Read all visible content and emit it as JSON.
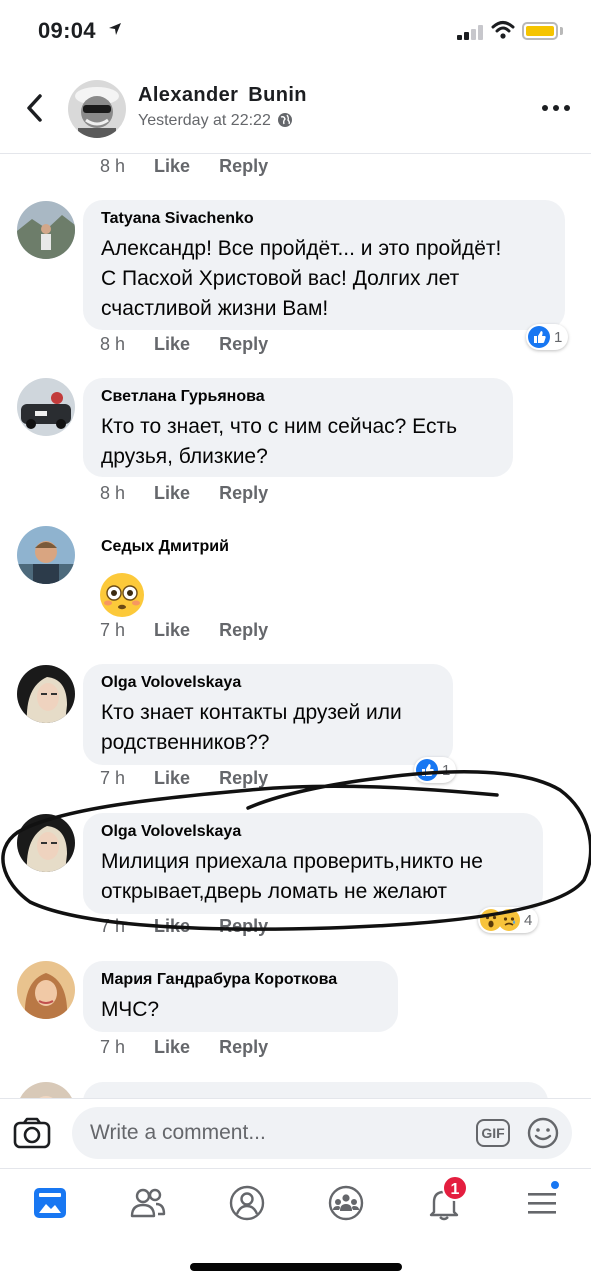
{
  "status_bar": {
    "time": "09:04"
  },
  "header": {
    "name": "Alexander  Bunin",
    "meta": "Yesterday at 22:22"
  },
  "top_actions": {
    "time": "8 h",
    "like": "Like",
    "reply": "Reply"
  },
  "comments": [
    {
      "author": "Tatyana  Sivachenko",
      "lines": [
        "Александр! Все пройдёт... и это пройдёт!",
        "С Пасхой Христовой вас! Долгих лет",
        "счастливой жизни Вам!"
      ],
      "time": "8 h",
      "like": "Like",
      "reply": "Reply",
      "reaction_count": "1"
    },
    {
      "author": "Светлана Гурьянова",
      "lines": [
        "Кто то знает, что с ним сейчас? Есть",
        "друзья, близкие?"
      ],
      "time": "8 h",
      "like": "Like",
      "reply": "Reply"
    },
    {
      "author": "Седых Дмитрий",
      "lines": [],
      "emoji": "flushed-face",
      "time": "7 h",
      "like": "Like",
      "reply": "Reply"
    },
    {
      "author": "Olga Volovelskaya",
      "lines": [
        "Кто знает контакты друзей или",
        "родственников??"
      ],
      "time": "7 h",
      "like": "Like",
      "reply": "Reply",
      "reaction_count": "1"
    },
    {
      "author": "Olga Volovelskaya",
      "lines": [
        "Милиция приехала проверить,никто не",
        "открывает,дверь ломать не желают"
      ],
      "time": "7 h",
      "like": "Like",
      "reply": "Reply",
      "reaction_count": "4"
    },
    {
      "author": "Мария Гандрабура Короткова",
      "lines": [
        "МЧС?"
      ],
      "time": "7 h",
      "like": "Like",
      "reply": "Reply"
    }
  ],
  "composer": {
    "placeholder": "Write a comment...",
    "gif_label": "GIF"
  },
  "tabbar": {
    "notifications_badge": "1"
  },
  "colors": {
    "accent": "#1877f2",
    "badge": "#e41e3f",
    "bubble": "#f0f2f5",
    "muted": "#65676b"
  }
}
